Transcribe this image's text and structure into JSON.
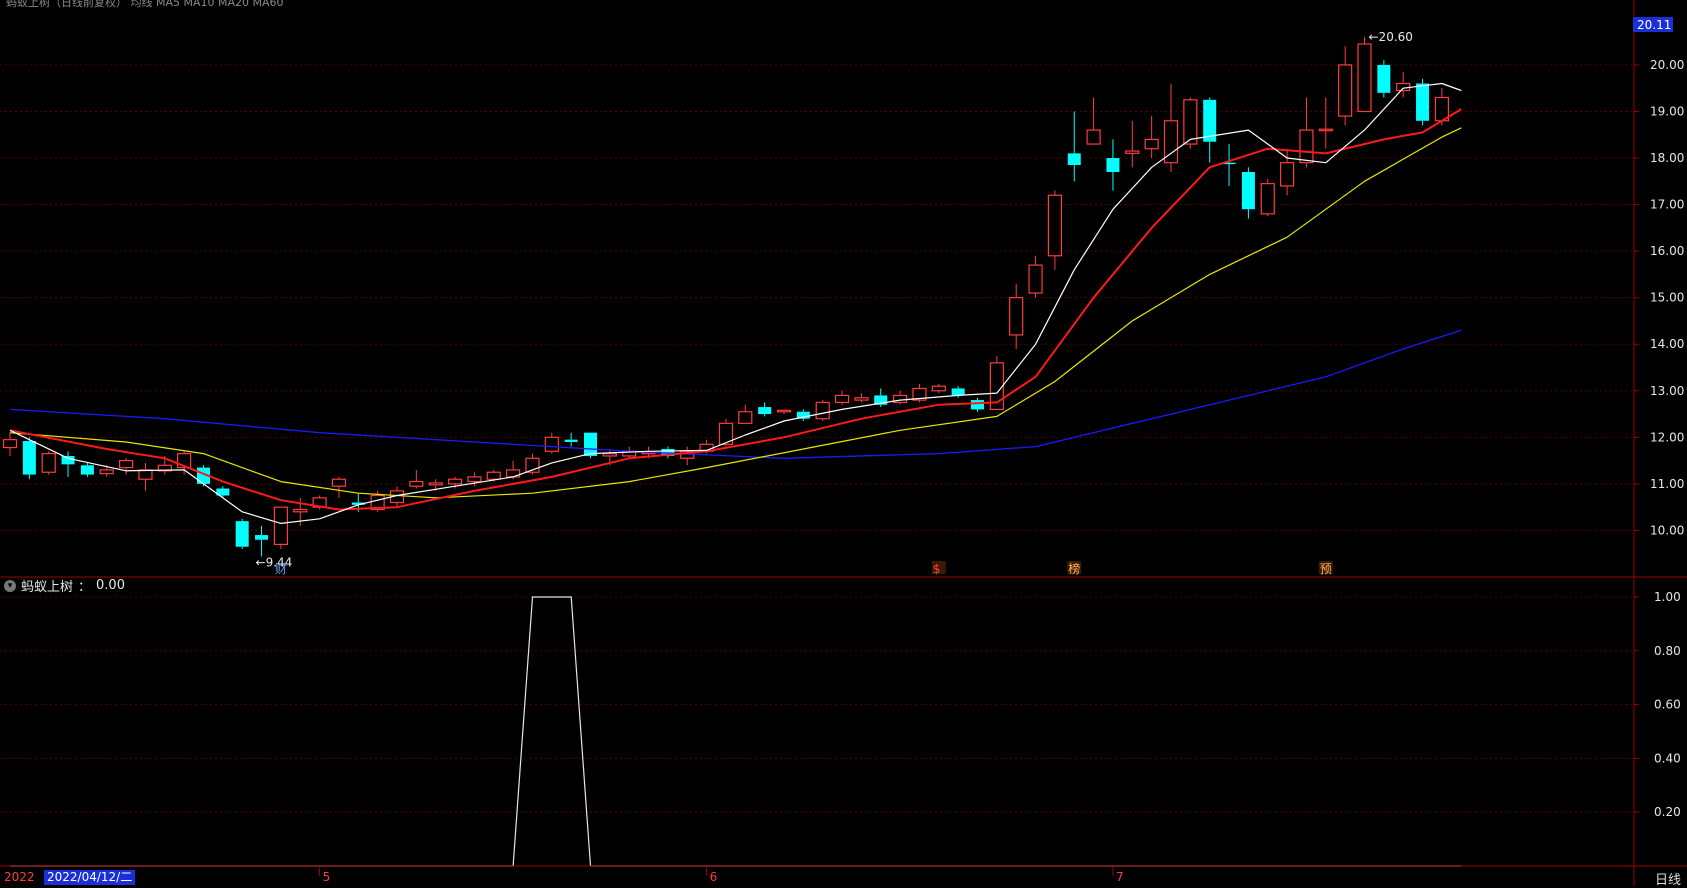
{
  "header": {
    "status_text": "蚂蚁上树（日线前复权）  均线 MA5 MA10 MA20 MA60",
    "price_tag": "20.11"
  },
  "colors": {
    "up": "#ff3c3c",
    "down": "#00ffff",
    "ma5": "#ffffff",
    "ma10": "#ff1a1a",
    "ma20": "#e8e800",
    "ma60": "#1a1aff",
    "grid": "#5a0000",
    "axis": "#a00000",
    "price_tag_bg": "#1b2fd6"
  },
  "chart_data": [
    {
      "type": "candlestick",
      "y_axis_ticks": [
        "20.00",
        "19.00",
        "18.00",
        "17.00",
        "16.00",
        "15.00",
        "14.00",
        "13.00",
        "12.00",
        "11.00",
        "10.00"
      ],
      "ylim": [
        9.15,
        20.75
      ],
      "annotations": {
        "high": "20.60",
        "low": "9.44"
      },
      "month_labels": [
        "5",
        "6",
        "7"
      ],
      "event_markers": [
        "财",
        "$",
        "榜",
        "预"
      ],
      "candles": [
        [
          11.78,
          11.95,
          12.1,
          11.6
        ],
        [
          11.92,
          11.2,
          12.0,
          11.1
        ],
        [
          11.25,
          11.65,
          11.7,
          11.2
        ],
        [
          11.6,
          11.42,
          11.7,
          11.15
        ],
        [
          11.4,
          11.2,
          11.45,
          11.15
        ],
        [
          11.22,
          11.3,
          11.4,
          11.15
        ],
        [
          11.35,
          11.5,
          11.55,
          11.2
        ],
        [
          11.1,
          11.3,
          11.45,
          10.85
        ],
        [
          11.28,
          11.4,
          11.6,
          11.2
        ],
        [
          11.35,
          11.65,
          11.7,
          11.2
        ],
        [
          11.35,
          11.0,
          11.4,
          10.95
        ],
        [
          10.9,
          10.75,
          10.95,
          10.7
        ],
        [
          10.2,
          9.65,
          10.25,
          9.6
        ],
        [
          9.9,
          9.8,
          10.1,
          9.44
        ],
        [
          9.7,
          10.5,
          10.5,
          9.6
        ],
        [
          10.4,
          10.45,
          10.7,
          10.1
        ],
        [
          10.5,
          10.7,
          10.75,
          10.45
        ],
        [
          10.95,
          11.1,
          11.15,
          10.7
        ],
        [
          10.6,
          10.55,
          10.8,
          10.4
        ],
        [
          10.45,
          10.75,
          10.85,
          10.4
        ],
        [
          10.6,
          10.85,
          10.95,
          10.5
        ],
        [
          10.95,
          11.05,
          11.3,
          10.9
        ],
        [
          10.98,
          11.02,
          11.1,
          10.85
        ],
        [
          11.0,
          11.1,
          11.15,
          10.9
        ],
        [
          11.05,
          11.15,
          11.25,
          10.95
        ],
        [
          11.1,
          11.25,
          11.3,
          11.05
        ],
        [
          11.15,
          11.3,
          11.5,
          11.1
        ],
        [
          11.25,
          11.55,
          11.65,
          11.2
        ],
        [
          11.7,
          12.0,
          12.1,
          11.65
        ],
        [
          11.95,
          11.9,
          12.1,
          11.8
        ],
        [
          12.1,
          11.6,
          12.1,
          11.55
        ],
        [
          11.6,
          11.65,
          11.75,
          11.4
        ],
        [
          11.6,
          11.7,
          11.8,
          11.55
        ],
        [
          11.65,
          11.68,
          11.8,
          11.55
        ],
        [
          11.75,
          11.6,
          11.8,
          11.55
        ],
        [
          11.55,
          11.7,
          11.8,
          11.4
        ],
        [
          11.7,
          11.85,
          11.95,
          11.65
        ],
        [
          11.85,
          12.3,
          12.4,
          11.8
        ],
        [
          12.3,
          12.55,
          12.7,
          12.3
        ],
        [
          12.65,
          12.5,
          12.75,
          12.45
        ],
        [
          12.55,
          12.58,
          12.6,
          12.5
        ],
        [
          12.55,
          12.4,
          12.6,
          12.35
        ],
        [
          12.4,
          12.75,
          12.8,
          12.35
        ],
        [
          12.75,
          12.9,
          13.0,
          12.7
        ],
        [
          12.8,
          12.85,
          12.95,
          12.75
        ],
        [
          12.9,
          12.7,
          13.05,
          12.65
        ],
        [
          12.75,
          12.9,
          13.0,
          12.7
        ],
        [
          12.8,
          13.05,
          13.15,
          12.75
        ],
        [
          13.0,
          13.1,
          13.15,
          12.95
        ],
        [
          13.05,
          12.9,
          13.1,
          12.85
        ],
        [
          12.8,
          12.6,
          12.85,
          12.55
        ],
        [
          12.6,
          13.6,
          13.75,
          12.6
        ],
        [
          14.2,
          15.0,
          15.3,
          13.9
        ],
        [
          15.1,
          15.7,
          15.9,
          15.0
        ],
        [
          15.9,
          17.2,
          17.3,
          15.6
        ],
        [
          18.1,
          17.85,
          19.0,
          17.5
        ],
        [
          18.3,
          18.6,
          19.3,
          18.3
        ],
        [
          18.0,
          17.7,
          18.4,
          17.3
        ],
        [
          18.1,
          18.15,
          18.8,
          17.8
        ],
        [
          18.2,
          18.4,
          18.9,
          18.0
        ],
        [
          17.9,
          18.8,
          19.6,
          17.7
        ],
        [
          18.3,
          19.25,
          19.3,
          18.2
        ],
        [
          19.25,
          18.35,
          19.3,
          17.9
        ],
        [
          17.9,
          17.88,
          18.3,
          17.4
        ],
        [
          17.7,
          16.9,
          17.8,
          16.7
        ],
        [
          16.8,
          17.45,
          17.55,
          16.75
        ],
        [
          17.4,
          17.9,
          18.2,
          17.2
        ],
        [
          17.9,
          18.6,
          19.3,
          17.8
        ],
        [
          18.6,
          18.62,
          19.3,
          18.2
        ],
        [
          18.9,
          20.0,
          20.4,
          18.7
        ],
        [
          19.0,
          20.45,
          20.6,
          19.0
        ],
        [
          20.0,
          19.4,
          20.1,
          19.3
        ],
        [
          19.45,
          19.6,
          19.85,
          19.3
        ],
        [
          19.6,
          18.8,
          19.7,
          18.7
        ],
        [
          18.8,
          19.3,
          19.5,
          18.7
        ]
      ],
      "ma5": [
        [
          0,
          12.15
        ],
        [
          3,
          11.55
        ],
        [
          6,
          11.28
        ],
        [
          9,
          11.3
        ],
        [
          12,
          10.4
        ],
        [
          14,
          10.15
        ],
        [
          16,
          10.25
        ],
        [
          18,
          10.55
        ],
        [
          20,
          10.75
        ],
        [
          23,
          10.95
        ],
        [
          26,
          11.15
        ],
        [
          28,
          11.45
        ],
        [
          30,
          11.65
        ],
        [
          33,
          11.7
        ],
        [
          36,
          11.72
        ],
        [
          38,
          12.05
        ],
        [
          40,
          12.35
        ],
        [
          43,
          12.6
        ],
        [
          46,
          12.8
        ],
        [
          49,
          12.9
        ],
        [
          51,
          12.95
        ],
        [
          53,
          14.0
        ],
        [
          55,
          15.6
        ],
        [
          57,
          16.9
        ],
        [
          59,
          17.8
        ],
        [
          61,
          18.4
        ],
        [
          64,
          18.6
        ],
        [
          66,
          18.0
        ],
        [
          68,
          17.9
        ],
        [
          70,
          18.6
        ],
        [
          72,
          19.5
        ],
        [
          74,
          19.6
        ],
        [
          75,
          19.45
        ]
      ],
      "ma10": [
        [
          0,
          12.15
        ],
        [
          5,
          11.75
        ],
        [
          8,
          11.55
        ],
        [
          11,
          11.05
        ],
        [
          14,
          10.65
        ],
        [
          17,
          10.45
        ],
        [
          20,
          10.5
        ],
        [
          24,
          10.85
        ],
        [
          28,
          11.15
        ],
        [
          32,
          11.55
        ],
        [
          36,
          11.7
        ],
        [
          40,
          12.0
        ],
        [
          44,
          12.4
        ],
        [
          48,
          12.7
        ],
        [
          51,
          12.75
        ],
        [
          53,
          13.3
        ],
        [
          56,
          15.0
        ],
        [
          59,
          16.5
        ],
        [
          62,
          17.8
        ],
        [
          65,
          18.2
        ],
        [
          68,
          18.1
        ],
        [
          71,
          18.4
        ],
        [
          73,
          18.55
        ],
        [
          75,
          19.05
        ]
      ],
      "ma20": [
        [
          0,
          12.1
        ],
        [
          6,
          11.9
        ],
        [
          10,
          11.65
        ],
        [
          14,
          11.05
        ],
        [
          18,
          10.8
        ],
        [
          22,
          10.7
        ],
        [
          27,
          10.8
        ],
        [
          32,
          11.05
        ],
        [
          36,
          11.35
        ],
        [
          41,
          11.75
        ],
        [
          46,
          12.15
        ],
        [
          51,
          12.45
        ],
        [
          54,
          13.2
        ],
        [
          58,
          14.5
        ],
        [
          62,
          15.5
        ],
        [
          66,
          16.3
        ],
        [
          70,
          17.5
        ],
        [
          74,
          18.45
        ],
        [
          75,
          18.65
        ]
      ],
      "ma60": [
        [
          0,
          12.6
        ],
        [
          8,
          12.4
        ],
        [
          16,
          12.1
        ],
        [
          24,
          11.9
        ],
        [
          32,
          11.7
        ],
        [
          40,
          11.55
        ],
        [
          48,
          11.65
        ],
        [
          53,
          11.8
        ],
        [
          58,
          12.3
        ],
        [
          63,
          12.8
        ],
        [
          68,
          13.3
        ],
        [
          72,
          13.9
        ],
        [
          75,
          14.3
        ]
      ]
    },
    {
      "type": "line",
      "title": "蚂蚁上树",
      "current_value": "0.00",
      "y_axis_ticks": [
        "1.00",
        "0.80",
        "0.60",
        "0.40",
        "0.20"
      ],
      "ylim": [
        0,
        1.0
      ],
      "x": [
        0,
        26,
        27,
        28,
        29,
        30,
        75
      ],
      "values": [
        0,
        0,
        1,
        1,
        1,
        0,
        0
      ]
    }
  ],
  "footer": {
    "year_prefix": "2022",
    "date_label": "2022/04/12/二",
    "period_label": "日线"
  }
}
